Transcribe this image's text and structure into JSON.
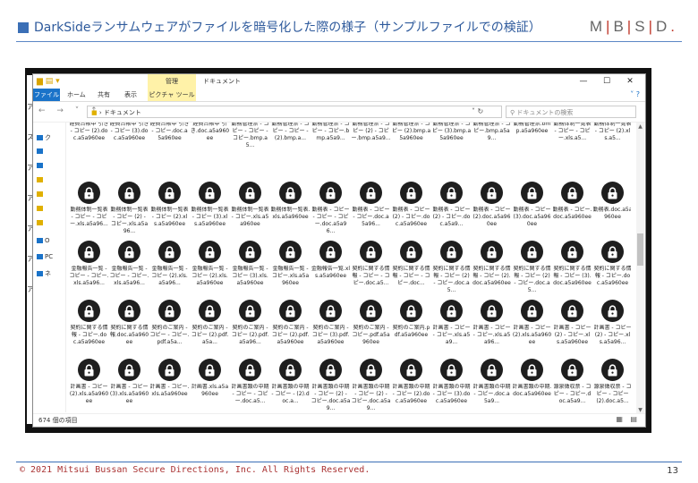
{
  "slide": {
    "title": "DarkSideランサムウェアがファイルを暗号化した際の様子（サンプルファイルでの検証）",
    "logo": [
      "M",
      "B",
      "S",
      "D"
    ],
    "copyright": "© 2021  Mitsui Bussan Secure Directions, Inc. All Rights Reserved.",
    "page_number": "13"
  },
  "background_doc_lines": [
    "ア",
    "ス",
    "ア",
    "ア",
    "ア",
    "ア",
    "ア"
  ],
  "explorer": {
    "context_tab": "管理",
    "window_title": "ドキュメント",
    "window_buttons": [
      "—",
      "☐",
      "✕"
    ],
    "ribbon_tabs": [
      {
        "label": "ファイル",
        "kind": "file"
      },
      {
        "label": "ホーム",
        "kind": "normal"
      },
      {
        "label": "共有",
        "kind": "normal"
      },
      {
        "label": "表示",
        "kind": "normal"
      },
      {
        "label": "ピクチャ ツール",
        "kind": "ctx"
      }
    ],
    "address": "ドキュメント",
    "search_placeholder": "ドキュメントの検索",
    "nav_items": [
      "ク",
      "",
      "",
      "",
      "",
      "",
      "",
      "O",
      "PC",
      "ネ"
    ],
    "status": "674 個の項目",
    "colors": {
      "file_tab": "#1a73c9",
      "context": "#fff2a8",
      "lock_icon": "#1e1e1e"
    }
  },
  "files": [
    "経費台帳中\n引き - コピー (2).doc.a5a960ee",
    "経費台帳中\n引き - コピー (3).doc.a5a960ee",
    "経費台帳中\n引き - コピー.doc.a5a960ee",
    "経費台帳中\n引き.doc.a5a960ee",
    "勤務管理票 - コピー - コピー - コピー.bmp.a5...",
    "勤務管理票 - コピー - コピー - (2).bmp.a...",
    "勤務管理票 - コピー - コピー.bmp.a5a9...",
    "勤務管理票 - コピー (2) - コピー.bmp.a5a9...",
    "勤務管理票 - コピー (2).bmp.a5a960ee",
    "勤務管理票 - コピー (3).bmp.a5a960ee",
    "勤務管理票 - コピー.bmp.a5a9...",
    "勤務管理票.bmp.a5a960ee",
    "勤務体制一覧表 - コピー - コピー.xls.a5...",
    "勤務体制一覧表 - コピー (2).xls.a5...",
    "勤務体制一覧表 - コピー - コピー.xls.a5a96...",
    "勤務体制一覧表 - コピー (2) - コピー.xls.a5a96...",
    "勤務体制一覧表 - コピー (2).xls.a5a960ee",
    "勤務体制一覧表 - コピー (3).xls.a5a960ee",
    "勤務体制一覧表 - コピー.xls.a5a960ee",
    "勤務体制一覧表.xls.a5a960ee",
    "勤務表 - コピー - コピー - コピー.doc.a5a96...",
    "勤務表 - コピー - コピー.doc.a5a96...",
    "勤務表 - コピー (2) - コピー.doc.a5a960ee",
    "勤務表 - コピー (2) - コピー.doc.a5a9...",
    "勤務表 - コピー (2).doc.a5a960ee",
    "勤務表 - コピー (3).doc.a5a960ee",
    "勤務表 - コピー.doc.a5a960ee",
    "勤務表.doc.a5a960ee",
    "金融報告一覧 - コピー - コピー.xls.a5a96...",
    "金融報告一覧 - コピー - コピー.xls.a5a96...",
    "金融報告一覧 - コピー (2).xls.a5a96...",
    "金融報告一覧 - コピー (2).xls.a5a960ee",
    "金融報告一覧 - コピー (3).xls.a5a960ee",
    "金融報告一覧 - コピー.xls.a5a960ee",
    "金融報告一覧.xls.a5a960ee",
    "契約に関する情報 - コピー - コピー.doc.a5...",
    "契約に関する情報 - コピー - コピー.doc...",
    "契約に関する情報 - コピー (2) - コピー.doc.a5...",
    "契約に関する情報 - コピー (2).doc.a5a960ee",
    "契約に関する情報 - コピー (2) - コピー.doc.a5...",
    "契約に関する情報 - コピー (3).doc.a5a960ee",
    "契約に関する情報 - コピー.doc.a5a960ee",
    "契約に関する情報 - コピー.doc.a5a960ee",
    "契約に関する情報.doc.a5a960ee",
    "契約のご案内 - コピー - コピー.pdf.a5a...",
    "契約のご案内 - コピー (2).pdf.a5a...",
    "契約のご案内 - コピー (2).pdf.a5a96...",
    "契約のご案内 - コピー (2).pdf.a5a960ee",
    "契約のご案内 - コピー (3).pdf.a5a960ee",
    "契約のご案内 - コピー.pdf.a5a960ee",
    "契約のご案内.pdf.a5a960ee",
    "計画書 - コピー - コピー.xls.a5a9...",
    "計画書 - コピー - コピー.xls.a5a96...",
    "計画書 - コピー (2).xls.a5a960ee",
    "計画書 - コピー (2) - コピー.xls.a5a960ee",
    "計画書 - コピー (2) - コピー.xls.a5a96...",
    "計画書 - コピー (2).xls.a5a960ee",
    "計画書 - コピー (3).xls.a5a960ee",
    "計画書 - コピー.xls.a5a960ee",
    "計画書.xls.a5a960ee",
    "計画書類の中期 - コピー - コピー.doc.a5...",
    "計画書類の中期 - コピー - (2).doc.a...",
    "計画書類の中期 - コピー (2) - コピー.doc.a5a9...",
    "計画書類の中期 - コピー (2) - コピー.doc.a5a9...",
    "計画書類の中期 - コピー (2).doc.a5a960ee",
    "計画書類の中期 - コピー (3).doc.a5a960ee",
    "計画書類の中期 - コピー.doc.a5a9...",
    "計画書類の中期.doc.a5a960ee",
    "源泉徴収票 - コピー - コピー.doc.a5a9...",
    "源泉徴収票 - コピー - コピー (2).doc.a5...",
    "",
    "",
    "",
    "",
    "",
    "",
    "",
    "",
    "",
    "",
    "",
    "",
    "",
    ""
  ]
}
